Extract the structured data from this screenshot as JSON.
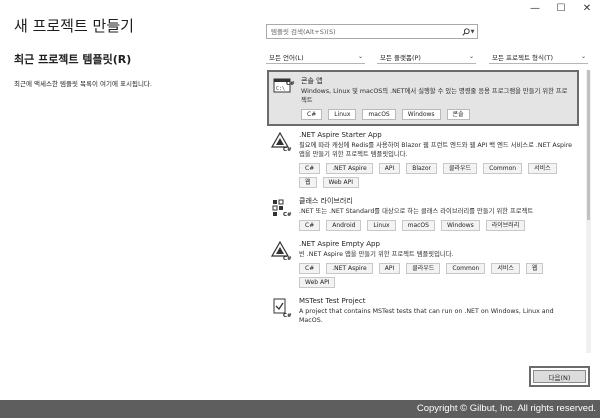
{
  "window": {
    "minimize": "—",
    "maximize": "☐",
    "close": "✕"
  },
  "page_title": "새 프로젝트 만들기",
  "recent": {
    "title": "최근 프로젝트 템플릿(R)",
    "empty_message": "최근에 액세스한 템플릿 목록이 여기에 표시됩니다."
  },
  "search": {
    "placeholder": "템플릿 검색(Alt+S)(S)",
    "icon": "search-icon"
  },
  "filters": [
    {
      "label": "모든 언어(L)"
    },
    {
      "label": "모든 플랫폼(P)"
    },
    {
      "label": "모든 프로젝트 형식(T)"
    }
  ],
  "templates": [
    {
      "name": "콘솔 앱",
      "icon": "console-app-icon",
      "selected": true,
      "description": "Windows, Linux 및 macOS의 .NET에서 실행할 수 있는 명령줄 응용 프로그램을 만들기 위한 프로젝트",
      "tags": [
        "C#",
        "Linux",
        "macOS",
        "Windows",
        "콘솔"
      ]
    },
    {
      "name": ".NET Aspire Starter App",
      "icon": "aspire-icon",
      "selected": false,
      "description": "필요에 따라 캐싱에 Redis를 사용하여 Blazor 웹 프런트 엔드와 웹 API 백 엔드 서비스로 .NET Aspire 앱을 만들기 위한 프로젝트 템플릿입니다.",
      "tags": [
        "C#",
        ".NET Aspire",
        "API",
        "Blazor",
        "클라우드",
        "Common",
        "서비스",
        "웹",
        "Web API"
      ]
    },
    {
      "name": "클래스 라이브러리",
      "icon": "class-library-icon",
      "selected": false,
      "description": ".NET 또는 .NET Standard를 대상으로 하는 클래스 라이브러리를 만들기 위한 프로젝트",
      "tags": [
        "C#",
        "Android",
        "Linux",
        "macOS",
        "Windows",
        "라이브러리"
      ]
    },
    {
      "name": ".NET Aspire Empty App",
      "icon": "aspire-icon",
      "selected": false,
      "description": "빈 .NET Aspire 앱을 만들기 위한 프로젝트 템플릿입니다.",
      "tags": [
        "C#",
        ".NET Aspire",
        "API",
        "클라우드",
        "Common",
        "서비스",
        "웹",
        "Web API"
      ]
    },
    {
      "name": "MSTest Test Project",
      "icon": "test-project-icon",
      "selected": false,
      "description": "A project that contains MSTest tests that can run on .NET on Windows, Linux and MacOS.",
      "tags": []
    }
  ],
  "next_button": "다음(N)",
  "copyright": "Copyright © Gilbut, Inc. All rights reserved."
}
